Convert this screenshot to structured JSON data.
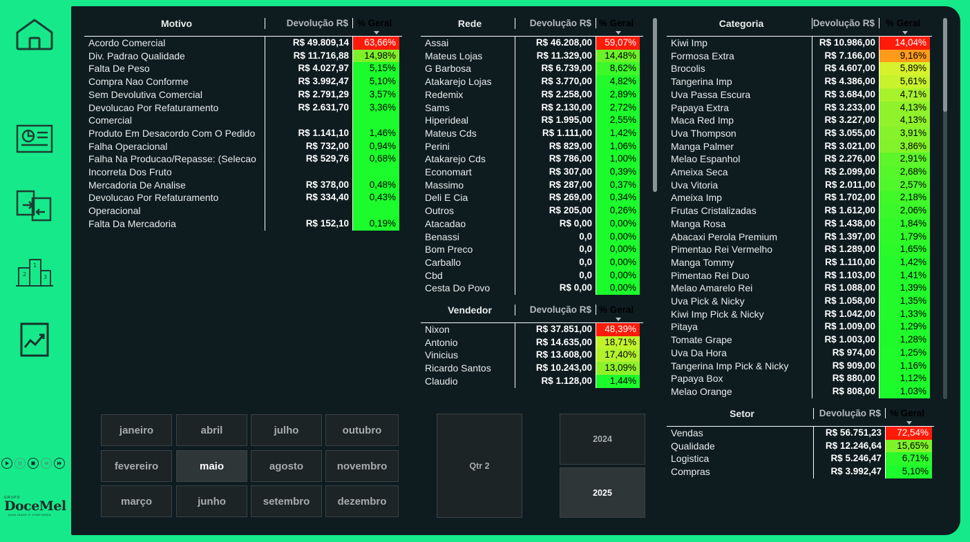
{
  "colors": {
    "background": "#16e98a",
    "panel": "#0e1c20",
    "red": "#ff1a0a",
    "green": "#1dfc2c"
  },
  "sidebar": {
    "icons": [
      "home-icon",
      "presentation-icon",
      "transfer-icon",
      "podium-icon",
      "line-chart-icon"
    ]
  },
  "playback": [
    "play-icon",
    "pause-icon",
    "stop-icon",
    "previous-icon",
    "next-icon"
  ],
  "logo": {
    "grupo": "GRUPO",
    "name": "DoceMel",
    "tagline": "QUALIDADE E CONFIANÇA"
  },
  "motivo": {
    "headers": {
      "col1": "Motivo",
      "col2": "Devolução R$",
      "col3": "% Geral"
    },
    "rows": [
      {
        "label": "Acordo Comercial",
        "value": "R$ 49.809,14",
        "pct": "63,66%",
        "color": "#ff1a0a"
      },
      {
        "label": "Div. Padrao Qualidade",
        "value": "R$ 11.716,88",
        "pct": "14,98%",
        "color": "#7ef02a"
      },
      {
        "label": "Falta De Peso",
        "value": "R$ 4.027,97",
        "pct": "5,15%",
        "color": "#1cfb2b"
      },
      {
        "label": "Compra Nao Conforme",
        "value": "R$ 3.992,47",
        "pct": "5,10%",
        "color": "#1cfb2b"
      },
      {
        "label": "Sem Devolutiva Comercial",
        "value": "R$ 2.791,29",
        "pct": "3,57%",
        "color": "#1cfb2b"
      },
      {
        "label": "Devolucao Por Refaturamento Comercial",
        "value": "R$ 2.631,70",
        "pct": "3,36%",
        "color": "#1cfb2b"
      },
      {
        "label": "Produto Em Desacordo Com O Pedido",
        "value": "R$ 1.141,10",
        "pct": "1,46%",
        "color": "#1cfb2b"
      },
      {
        "label": "Falha Operacional",
        "value": "R$ 732,00",
        "pct": "0,94%",
        "color": "#1cfb2b"
      },
      {
        "label": "Falha Na Producao/Repasse: (Selecao Incorreta Dos Fruto",
        "value": "R$ 529,76",
        "pct": "0,68%",
        "color": "#1cfb2b"
      },
      {
        "label": "Mercadoria De Analise",
        "value": "R$ 378,00",
        "pct": "0,48%",
        "color": "#1cfb2b"
      },
      {
        "label": "Devolucao Por Refaturamento Operacional",
        "value": "R$ 334,40",
        "pct": "0,43%",
        "color": "#1cfb2b"
      },
      {
        "label": "Falta Da Mercadoria",
        "value": "R$ 152,10",
        "pct": "0,19%",
        "color": "#1cfb2b"
      }
    ]
  },
  "rede": {
    "headers": {
      "col1": "Rede",
      "col2": "Devolução R$",
      "col3": "% Geral"
    },
    "rows": [
      {
        "label": "Assai",
        "value": "R$ 46.208,00",
        "pct": "59,07%",
        "color": "#ff1a0a"
      },
      {
        "label": "Mateus Lojas",
        "value": "R$ 11.329,00",
        "pct": "14,48%",
        "color": "#6cf228"
      },
      {
        "label": "G Barbosa",
        "value": "R$ 6.739,00",
        "pct": "8,62%",
        "color": "#3df82a"
      },
      {
        "label": "Atakarejo Lojas",
        "value": "R$ 3.770,00",
        "pct": "4,82%",
        "color": "#22fa2b"
      },
      {
        "label": "Redemix",
        "value": "R$ 2.258,00",
        "pct": "2,89%",
        "color": "#1cfb2b"
      },
      {
        "label": "Sams",
        "value": "R$ 2.130,00",
        "pct": "2,72%",
        "color": "#1cfb2b"
      },
      {
        "label": "Hiperideal",
        "value": "R$ 1.995,00",
        "pct": "2,55%",
        "color": "#1cfb2b"
      },
      {
        "label": "Mateus Cds",
        "value": "R$ 1.111,00",
        "pct": "1,42%",
        "color": "#1cfb2b"
      },
      {
        "label": "Perini",
        "value": "R$ 829,00",
        "pct": "1,06%",
        "color": "#1cfb2b"
      },
      {
        "label": "Atakarejo Cds",
        "value": "R$ 786,00",
        "pct": "1,00%",
        "color": "#1cfb2b"
      },
      {
        "label": "Economart",
        "value": "R$ 307,00",
        "pct": "0,39%",
        "color": "#1cfb2b"
      },
      {
        "label": "Massimo",
        "value": "R$ 287,00",
        "pct": "0,37%",
        "color": "#1cfb2b"
      },
      {
        "label": "Deli E Cia",
        "value": "R$ 269,00",
        "pct": "0,34%",
        "color": "#1cfb2b"
      },
      {
        "label": "Outros",
        "value": "R$ 205,00",
        "pct": "0,26%",
        "color": "#1cfb2b"
      },
      {
        "label": "Atacadao",
        "value": "R$ 0,00",
        "pct": "0,00%",
        "color": "#1cfb2b"
      },
      {
        "label": "Benassi",
        "value": "0,0",
        "pct": "0,00%",
        "color": "#1cfb2b"
      },
      {
        "label": "Bom Preco",
        "value": "0,0",
        "pct": "0,00%",
        "color": "#1cfb2b"
      },
      {
        "label": "Carballo",
        "value": "0,0",
        "pct": "0,00%",
        "color": "#1cfb2b"
      },
      {
        "label": "Cbd",
        "value": "0,0",
        "pct": "0,00%",
        "color": "#1cfb2b"
      },
      {
        "label": "Cesta Do Povo",
        "value": "R$ 0,00",
        "pct": "0,00%",
        "color": "#1cfb2b"
      }
    ]
  },
  "vendedor": {
    "headers": {
      "col1": "Vendedor",
      "col2": "Devolução R$",
      "col3": "% Geral"
    },
    "rows": [
      {
        "label": "Nixon",
        "value": "R$ 37.851,00",
        "pct": "48,39%",
        "color": "#ff1a0a"
      },
      {
        "label": "Antonio",
        "value": "R$ 14.635,00",
        "pct": "18,71%",
        "color": "#c2f22c"
      },
      {
        "label": "Vinicius",
        "value": "R$ 13.608,00",
        "pct": "17,40%",
        "color": "#b2f22c"
      },
      {
        "label": "Ricardo Santos",
        "value": "R$ 10.243,00",
        "pct": "13,09%",
        "color": "#8ef22b"
      },
      {
        "label": "Claudio",
        "value": "R$ 1.128,00",
        "pct": "1,44%",
        "color": "#1cfb2b"
      }
    ]
  },
  "categoria": {
    "headers": {
      "col1": "Categoria",
      "col2": "Devolução R$",
      "col3": "% Geral"
    },
    "rows": [
      {
        "label": "Kiwi Imp",
        "value": "R$ 10.986,00",
        "pct": "14,04%",
        "color": "#ff1a0a"
      },
      {
        "label": "Formosa Extra",
        "value": "R$ 7.166,00",
        "pct": "9,16%",
        "color": "#ff9b1a"
      },
      {
        "label": "Brocolis",
        "value": "R$ 4.607,00",
        "pct": "5,89%",
        "color": "#d6f22c"
      },
      {
        "label": "Tangerina Imp",
        "value": "R$ 4.386,00",
        "pct": "5,61%",
        "color": "#c7f22c"
      },
      {
        "label": "Uva Passa Escura",
        "value": "R$ 3.684,00",
        "pct": "4,71%",
        "color": "#a8f22c"
      },
      {
        "label": "Papaya Extra",
        "value": "R$ 3.233,00",
        "pct": "4,13%",
        "color": "#8ff22b"
      },
      {
        "label": "Maca Red Imp",
        "value": "R$ 3.227,00",
        "pct": "4,13%",
        "color": "#8ff22b"
      },
      {
        "label": "Uva Thompson",
        "value": "R$ 3.055,00",
        "pct": "3,91%",
        "color": "#86f22b"
      },
      {
        "label": "Manga Palmer",
        "value": "R$ 3.021,00",
        "pct": "3,86%",
        "color": "#84f22b"
      },
      {
        "label": "Melao Espanhol",
        "value": "R$ 2.276,00",
        "pct": "2,91%",
        "color": "#5ef52a"
      },
      {
        "label": "Ameixa Seca",
        "value": "R$ 2.099,00",
        "pct": "2,68%",
        "color": "#55f62a"
      },
      {
        "label": "Uva Vitoria",
        "value": "R$ 2.011,00",
        "pct": "2,57%",
        "color": "#50f72a"
      },
      {
        "label": "Ameixa Imp",
        "value": "R$ 1.702,00",
        "pct": "2,18%",
        "color": "#40f82a"
      },
      {
        "label": "Frutas Cristalizadas",
        "value": "R$ 1.612,00",
        "pct": "2,06%",
        "color": "#3bf82a"
      },
      {
        "label": "Manga Rosa",
        "value": "R$ 1.438,00",
        "pct": "1,84%",
        "color": "#32f92a"
      },
      {
        "label": "Abacaxi Perola Premium",
        "value": "R$ 1.397,00",
        "pct": "1,79%",
        "color": "#30f92a"
      },
      {
        "label": "Pimentao Rei Vermelho",
        "value": "R$ 1.289,00",
        "pct": "1,65%",
        "color": "#2bf92a"
      },
      {
        "label": "Manga Tommy",
        "value": "R$ 1.110,00",
        "pct": "1,42%",
        "color": "#24fa2b"
      },
      {
        "label": "Pimentao Rei Duo",
        "value": "R$ 1.103,00",
        "pct": "1,41%",
        "color": "#24fa2b"
      },
      {
        "label": "Melao Amarelo Rei",
        "value": "R$ 1.088,00",
        "pct": "1,39%",
        "color": "#23fa2b"
      },
      {
        "label": "Uva Pick & Nicky",
        "value": "R$ 1.058,00",
        "pct": "1,35%",
        "color": "#22fa2b"
      },
      {
        "label": "Kiwi Imp Pick & Nicky",
        "value": "R$ 1.042,00",
        "pct": "1,33%",
        "color": "#22fa2b"
      },
      {
        "label": "Pitaya",
        "value": "R$ 1.009,00",
        "pct": "1,29%",
        "color": "#20fa2b"
      },
      {
        "label": "Tomate Grape",
        "value": "R$ 1.003,00",
        "pct": "1,28%",
        "color": "#20fa2b"
      },
      {
        "label": "Uva Da Hora",
        "value": "R$ 974,00",
        "pct": "1,25%",
        "color": "#1ffb2b"
      },
      {
        "label": "Tangerina Imp Pick & Nicky",
        "value": "R$ 909,00",
        "pct": "1,16%",
        "color": "#1dfb2b"
      },
      {
        "label": "Papaya Box",
        "value": "R$ 880,00",
        "pct": "1,12%",
        "color": "#1dfb2b"
      },
      {
        "label": "Melao Orange",
        "value": "R$ 808,00",
        "pct": "1,03%",
        "color": "#1cfb2b"
      }
    ]
  },
  "setor": {
    "headers": {
      "col1": "Setor",
      "col2": "Devolução R$",
      "col3": "% Geral"
    },
    "rows": [
      {
        "label": "Vendas",
        "value": "R$ 56.751,23",
        "pct": "72,54%",
        "color": "#ff1a0a"
      },
      {
        "label": "Qualidade",
        "value": "R$ 12.246,64",
        "pct": "15,65%",
        "color": "#7ef22a"
      },
      {
        "label": "Logistica",
        "value": "R$ 5.246,47",
        "pct": "6,71%",
        "color": "#2cf92a"
      },
      {
        "label": "Compras",
        "value": "R$ 3.992,47",
        "pct": "5,10%",
        "color": "#1cfb2b"
      }
    ]
  },
  "months": {
    "items": [
      "janeiro",
      "abril",
      "julho",
      "outubro",
      "fevereiro",
      "maio",
      "agosto",
      "novembro",
      "março",
      "junho",
      "setembro",
      "dezembro"
    ],
    "selected": "maio"
  },
  "quarter": {
    "label": "Qtr 2"
  },
  "years": {
    "items": [
      "2024",
      "2025"
    ],
    "selected": "2025"
  }
}
